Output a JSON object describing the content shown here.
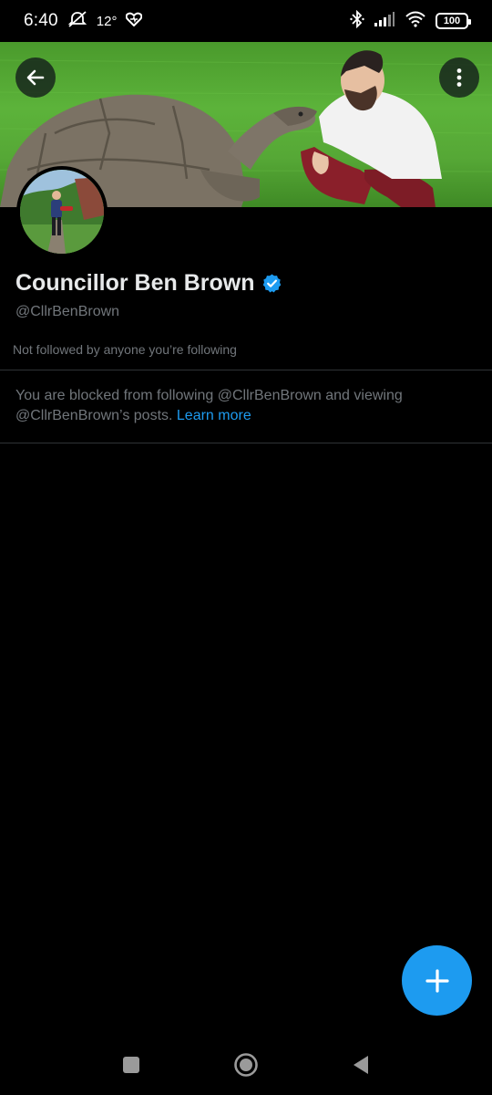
{
  "status_bar": {
    "time": "6:40",
    "temperature": "12°",
    "battery": "100",
    "icons": [
      "mute-alarm-icon",
      "heart-health-icon",
      "bluetooth-icon",
      "signal-icon",
      "wifi-icon",
      "battery-icon"
    ]
  },
  "header": {
    "back_icon": "arrow-left-icon",
    "more_icon": "more-vertical-icon"
  },
  "profile": {
    "display_name": "Councillor Ben Brown",
    "verified": true,
    "handle": "@CllrBenBrown",
    "followers_note": "Not followed by anyone you’re following"
  },
  "blocked_notice": {
    "text": "You are blocked from following @CllrBenBrown and viewing @CllrBenBrown’s posts.",
    "link_label": "Learn more"
  },
  "fab": {
    "icon": "plus-icon"
  },
  "nav_bar": {
    "icons": [
      "recents-square-icon",
      "home-circle-icon",
      "back-triangle-icon"
    ]
  },
  "colors": {
    "background": "#000000",
    "accent": "#1d9bf0",
    "primary_text": "#e7e9ea",
    "secondary_text": "#71767b",
    "divider": "#2f3336"
  }
}
